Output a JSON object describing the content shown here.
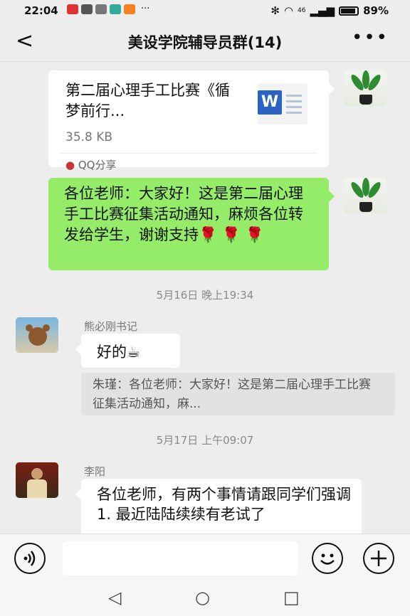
{
  "status_bar": {
    "time": "22:04",
    "network": "46",
    "battery": "89%",
    "overflow": "···"
  },
  "header": {
    "back_symbol": "<",
    "title": "美设学院辅导员群(14)",
    "more_symbol": "•••"
  },
  "messages": {
    "file": {
      "name": "第二届心理手工比赛《循梦前行...",
      "size": "35.8 KB",
      "icon_letter": "W",
      "source": "QQ分享"
    },
    "own_text": "各位老师：大家好！这是第二届心理手工比赛征集活动通知，麻烦各位转发给学生，谢谢支持🌹 🌹 🌹",
    "time1": "5月16日 晚上19:34",
    "reply": {
      "sender": "熊必刚书记",
      "text": "好的☕",
      "quote": "朱瑾：各位老师：大家好！这是第二届心理手工比赛征集活动通知，麻..."
    },
    "time2": "5月17日 上午09:07",
    "last": {
      "sender": "李阳",
      "text": "各位老师，有两个事情请跟同学们强调\n1. 最近陆陆续续有老试了"
    }
  },
  "input_bar": {
    "voice_icon": "voice-icon",
    "emoji_icon": "emoji-icon",
    "plus_icon": "plus-icon",
    "text_value": ""
  },
  "system_nav": {
    "back": "◁",
    "home": "○",
    "recents": "□"
  },
  "colors": {
    "own_bubble": "#95ec69",
    "background": "#ededed",
    "word_blue": "#2b63c5"
  }
}
